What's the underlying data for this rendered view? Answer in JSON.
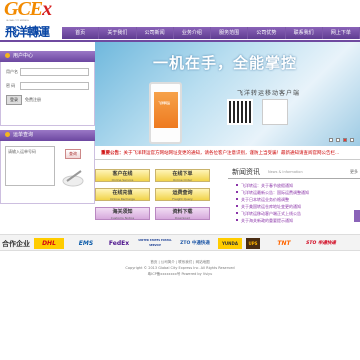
{
  "logo": {
    "brand_a": "GCE",
    "brand_b": "x",
    "tagline": "GLOBAL CITY EXPRESS",
    "chinese": "飛洋轉運"
  },
  "nav": [
    "首页",
    "关于我们",
    "公司新闻",
    "业务介绍",
    "服务范围",
    "公司优势",
    "联系我们",
    "网上下单"
  ],
  "login": {
    "title": "用户中心",
    "username_label": "用户名",
    "password_label": "密 码",
    "login_button": "登录",
    "register_link": "免费注册"
  },
  "tracking": {
    "title": "运单查询",
    "placeholder": "请输入运单号码",
    "query_button": "查询"
  },
  "banner": {
    "slogan": "一机在手，全能掌控",
    "subtitle": "飞洋转运移动客户端",
    "phone_label": "飞洋转运",
    "apple_glyph": "",
    "slides": 4,
    "active_slide": 1
  },
  "notice": {
    "label": "重要公告：",
    "text": "关于飞洋转运官方网站网址变更的通知，请各位客户注意识别，谨防上当受骗！最新通知请查阅官网公告栏..."
  },
  "services": [
    {
      "cn": "客户在线",
      "en": "Online Service",
      "style": "y"
    },
    {
      "cn": "在线下单",
      "en": "Online Order",
      "style": "y"
    },
    {
      "cn": "在线充值",
      "en": "Online Recharge",
      "style": "y"
    },
    {
      "cn": "运费查询",
      "en": "Freight Query",
      "style": "y"
    },
    {
      "cn": "海关须知",
      "en": "Customs Notice",
      "style": "p"
    },
    {
      "cn": "资料下载",
      "en": "Download",
      "style": "p"
    }
  ],
  "news": {
    "title": "新闻资讯",
    "title_en": "News & Information",
    "more": "更多",
    "items": [
      "飞洋转运：关于春节放假通知",
      "飞洋转运最新公告：国际运费调整通知",
      "关于日本转运业务价格调整",
      "关于美国转运仓库地址变更的通知",
      "飞洋转运移动客户端正式上线公告",
      "关于海关新政的重要提示通知"
    ]
  },
  "partners": {
    "label": "合作企业",
    "logos": [
      "DHL",
      "EMS",
      "FedEx",
      "UNITED STATES POSTAL SERVICE",
      "ZTO 中通快递",
      "YUNDA",
      "UPS",
      "TNT",
      "STO 申通快递"
    ]
  },
  "footer": {
    "line1": "首页 | 公司简介 | 联系我们 | 网站地图",
    "line2": "Copyright © 2013 Global City Express Inc. All Rights Reserved",
    "line3": "粤ICP备xxxxxxxx号  Powered by Vsiyu"
  },
  "colors": {
    "nav": "#6f4aa0",
    "accent": "#f28a00",
    "notice": "#cc0000"
  }
}
